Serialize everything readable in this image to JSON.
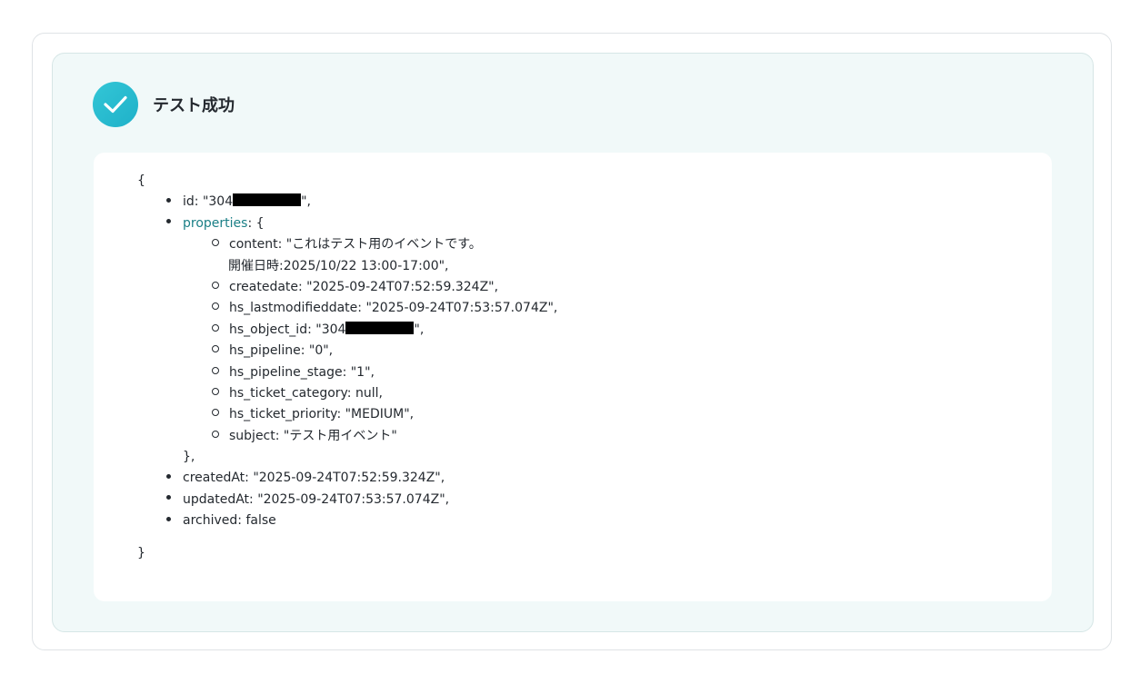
{
  "header": {
    "title": "テスト成功",
    "icon": "check-circle-icon",
    "accent": "#22bcd0"
  },
  "json": {
    "open_brace": "{",
    "close_brace": "}",
    "id_prefix": "id: \"304",
    "id_suffix": "\",",
    "properties_key": "properties",
    "properties_open": ": {",
    "properties_close": "},",
    "content_line1": "content: \"これはテスト用のイベントです。",
    "content_line2": "開催日時:2025/10/22 13:00-17:00\",",
    "createdate": "createdate: \"2025-09-24T07:52:59.324Z\",",
    "hs_lastmodifieddate": "hs_lastmodifieddate: \"2025-09-24T07:53:57.074Z\",",
    "hs_object_id_prefix": "hs_object_id: \"304",
    "hs_object_id_suffix": "\",",
    "hs_pipeline": "hs_pipeline: \"0\",",
    "hs_pipeline_stage": "hs_pipeline_stage: \"1\",",
    "hs_ticket_category": "hs_ticket_category: null,",
    "hs_ticket_priority": "hs_ticket_priority: \"MEDIUM\",",
    "subject": "subject: \"テスト用イベント\"",
    "createdAt": "createdAt: \"2025-09-24T07:52:59.324Z\",",
    "updatedAt": "updatedAt: \"2025-09-24T07:53:57.074Z\",",
    "archived": "archived: false"
  }
}
